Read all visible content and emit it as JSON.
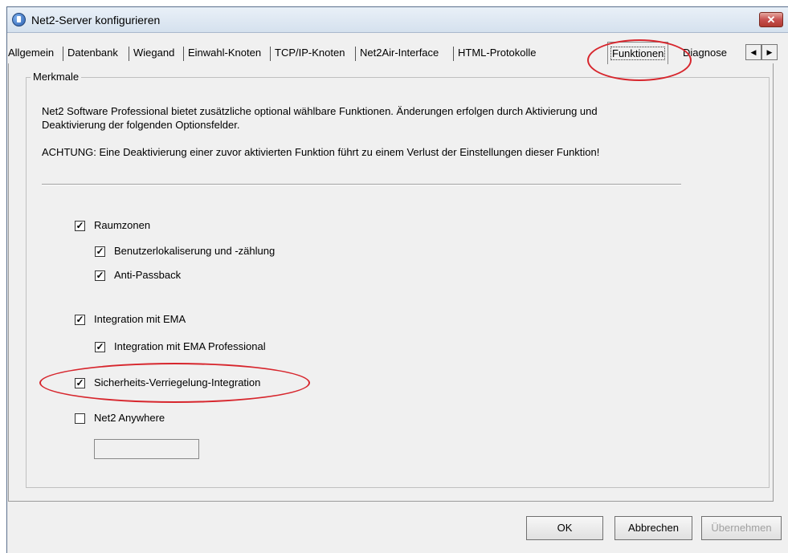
{
  "window": {
    "title": "Net2-Server konfigurieren",
    "close_label": "✕"
  },
  "tabs": [
    {
      "label": "Allgemein"
    },
    {
      "label": "Datenbank"
    },
    {
      "label": "Wiegand"
    },
    {
      "label": "Einwahl-Knoten"
    },
    {
      "label": "TCP/IP-Knoten"
    },
    {
      "label": "Net2Air-Interface"
    },
    {
      "label": "HTML-Protokolle"
    },
    {
      "label": "Funktionen",
      "active": true
    },
    {
      "label": "Diagnose"
    }
  ],
  "tab_scroll": {
    "left": "◀",
    "right": "▶"
  },
  "group": {
    "legend": "Merkmale",
    "description_line1": "Net2 Software Professional bietet zusätzliche optional wählbare Funktionen. Änderungen erfolgen durch Aktivierung und",
    "description_line2": "Deaktivierung der folgenden Optionsfelder.",
    "warning": "ACHTUNG: Eine Deaktivierung einer zuvor aktivierten Funktion führt zu einem Verlust der Einstellungen dieser Funktion!"
  },
  "options": [
    {
      "label": "Raumzonen",
      "checked": true
    },
    {
      "label": "Benutzerlokaliserung und -zählung",
      "checked": true
    },
    {
      "label": "Anti-Passback",
      "checked": true
    },
    {
      "label": "Integration mit EMA",
      "checked": true
    },
    {
      "label": "Integration mit EMA Professional",
      "checked": true
    },
    {
      "label": "Sicherheits-Verriegelung-Integration",
      "checked": true
    },
    {
      "label": "Net2 Anywhere",
      "checked": false
    }
  ],
  "net2_anywhere_value": "",
  "buttons": {
    "ok": "OK",
    "cancel": "Abbrechen",
    "apply": "Übernehmen"
  },
  "annotation_color": "#d7262d"
}
